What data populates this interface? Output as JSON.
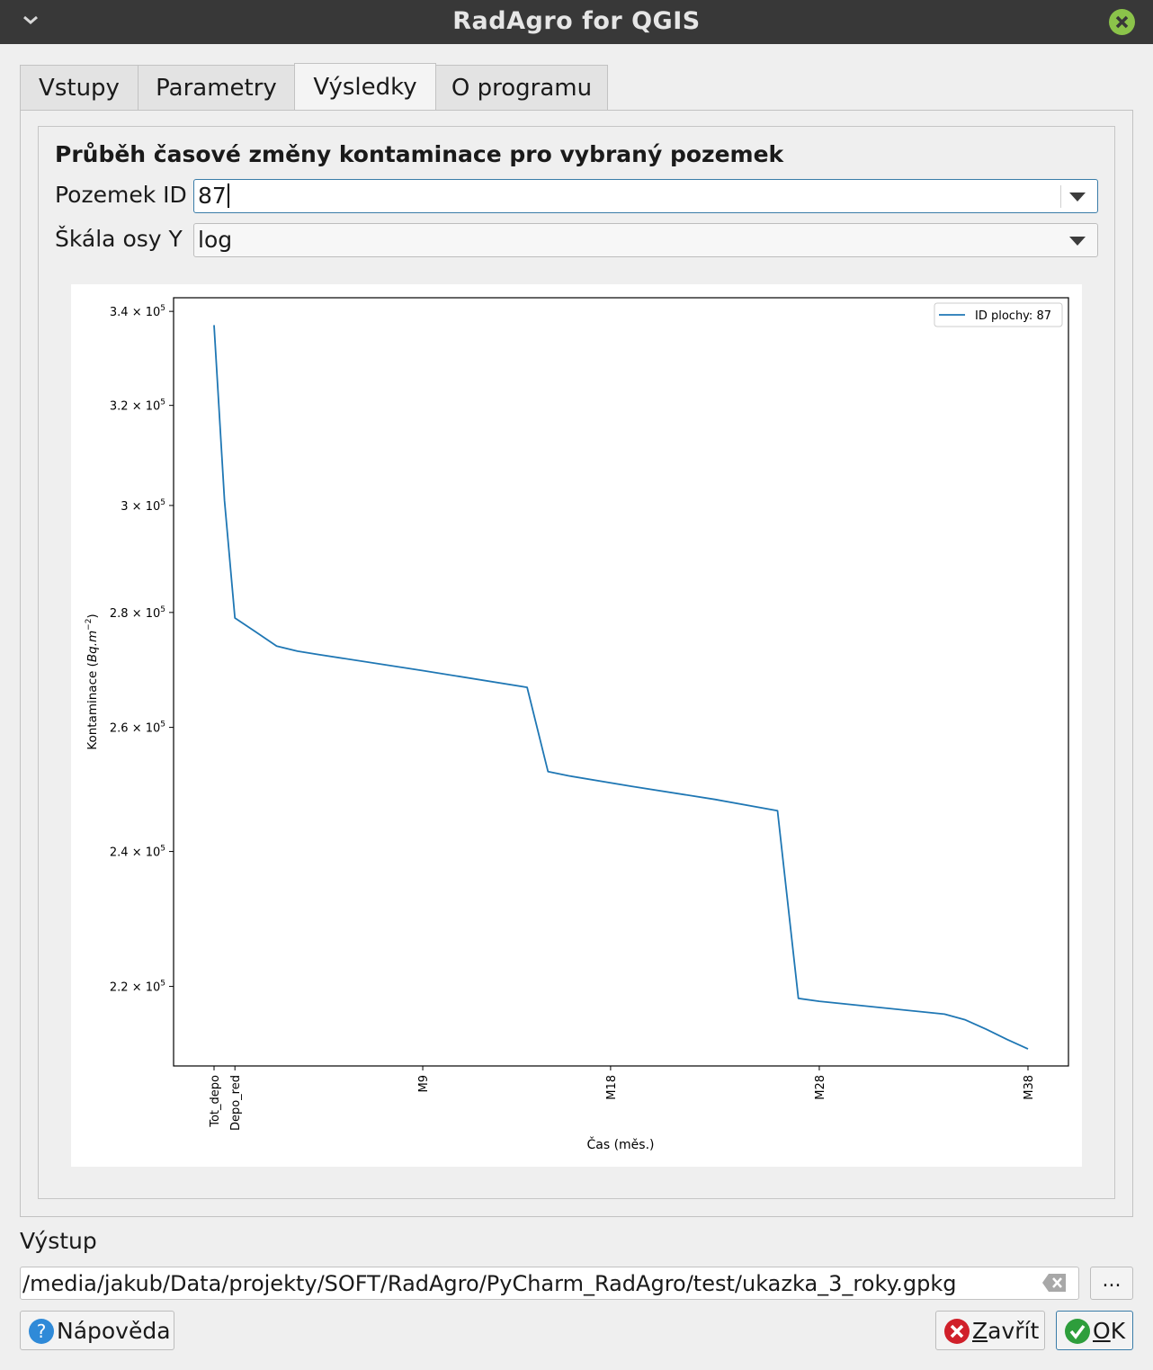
{
  "window": {
    "title": "RadAgro for QGIS"
  },
  "tabs": [
    {
      "label": "Vstupy",
      "active": false
    },
    {
      "label": "Parametry",
      "active": false
    },
    {
      "label": "Výsledky",
      "active": true
    },
    {
      "label": "O programu",
      "active": false
    }
  ],
  "results": {
    "heading": "Průběh časové změny kontaminace pro vybraný pozemek",
    "parcel_label": "Pozemek ID",
    "parcel_value": "87",
    "scale_label": "Škála osy Y",
    "scale_value": "log"
  },
  "chart_data": {
    "type": "line",
    "title": "",
    "xlabel": "Čas (měs.)",
    "ylabel": "Kontaminace (Bq.m⁻²)",
    "y_scale": "log",
    "ylim": [
      209000,
      343000
    ],
    "x_ticks": [
      {
        "pos": 0,
        "label": "Tot_depo"
      },
      {
        "pos": 1,
        "label": "Depo_red"
      },
      {
        "pos": 10,
        "label": "M9"
      },
      {
        "pos": 19,
        "label": "M18"
      },
      {
        "pos": 29,
        "label": "M28"
      },
      {
        "pos": 39,
        "label": "M38"
      }
    ],
    "y_ticks": [
      {
        "value": 220000,
        "mantissa": "2.2",
        "exp": "5"
      },
      {
        "value": 240000,
        "mantissa": "2.4",
        "exp": "5"
      },
      {
        "value": 260000,
        "mantissa": "2.6",
        "exp": "5"
      },
      {
        "value": 280000,
        "mantissa": "2.8",
        "exp": "5"
      },
      {
        "value": 300000,
        "mantissa": "3",
        "exp": "5"
      },
      {
        "value": 320000,
        "mantissa": "3.2",
        "exp": "5"
      },
      {
        "value": 340000,
        "mantissa": "3.4",
        "exp": "5"
      }
    ],
    "legend": {
      "position": "top-right",
      "entry": "ID plochy: 87"
    },
    "grid": false,
    "series": [
      {
        "name": "ID plochy: 87",
        "color": "#1f77b4",
        "x": [
          0,
          0.5,
          1,
          2,
          3,
          4,
          5,
          10,
          15,
          16,
          17,
          20,
          24,
          27,
          28,
          29,
          30,
          35,
          36,
          37,
          38,
          39
        ],
        "y": [
          337000,
          301000,
          279000,
          276500,
          274000,
          273100,
          272500,
          269700,
          266800,
          252700,
          252000,
          250300,
          248200,
          246400,
          218300,
          217900,
          217600,
          216100,
          215300,
          214000,
          212600,
          211300
        ]
      }
    ]
  },
  "output": {
    "label": "Výstup",
    "path": "/media/jakub/Data/projekty/SOFT/RadAgro/PyCharm_RadAgro/test/ukazka_3_roky.gpkg",
    "browse_label": "..."
  },
  "buttons": {
    "help": "Nápověda",
    "close_u": "Z",
    "close_rest": "avřít",
    "ok_u": "O",
    "ok_rest": "K"
  },
  "colors": {
    "titlebar": "#383838",
    "close_green": "#8bc34a",
    "help_blue": "#2f8ad8",
    "close_red": "#d0202a",
    "ok_green": "#2e9e3c",
    "series": "#1f77b4"
  }
}
